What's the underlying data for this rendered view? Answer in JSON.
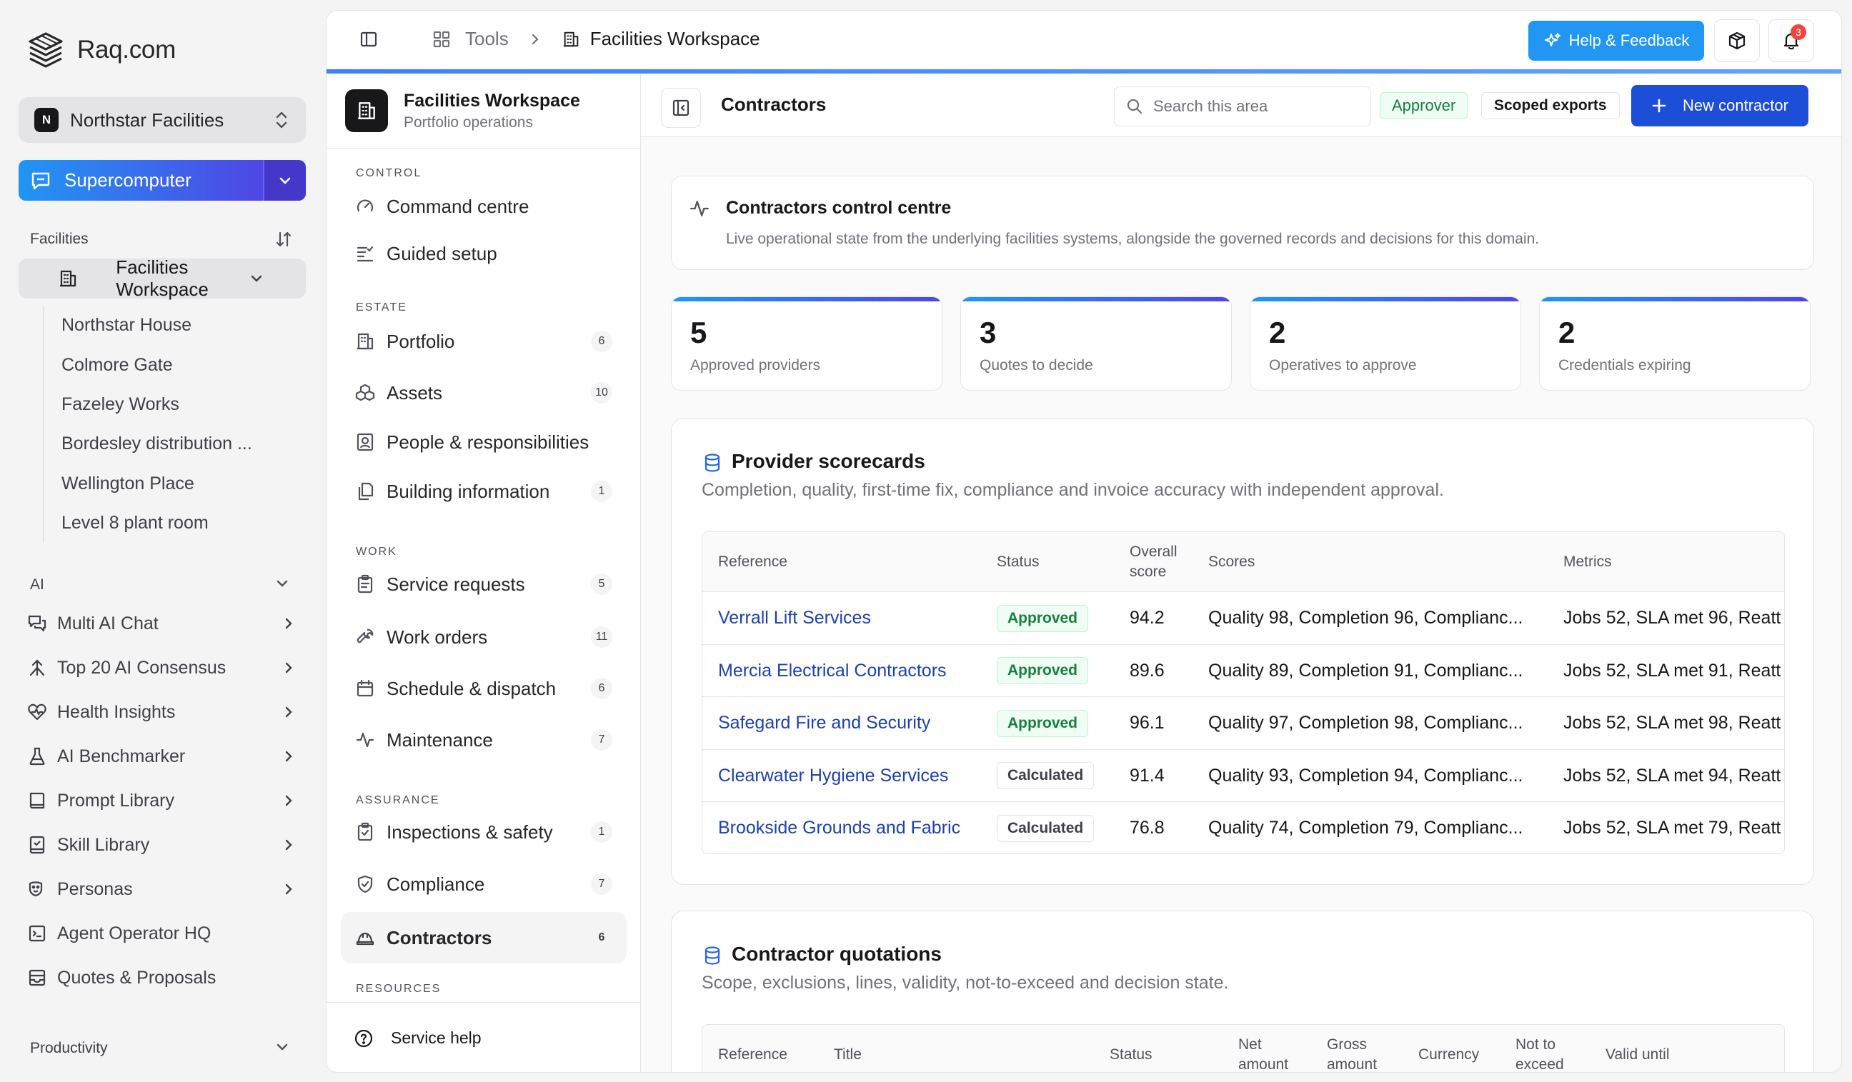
{
  "app": {
    "brand": "Raq.com"
  },
  "org": {
    "badge": "N",
    "name": "Northstar Facilities"
  },
  "supercomputer": {
    "label": "Supercomputer"
  },
  "facilities": {
    "heading": "Facilities",
    "workspace": "Facilities Workspace",
    "sites": [
      "Northstar House",
      "Colmore Gate",
      "Fazeley Works",
      "Bordesley distribution ...",
      "Wellington Place",
      "Level 8 plant room"
    ]
  },
  "ai": {
    "heading": "AI",
    "items": [
      {
        "label": "Multi AI Chat",
        "icon": "chat-icon",
        "chevron": true
      },
      {
        "label": "Top 20 AI Consensus",
        "icon": "consensus-icon",
        "chevron": true
      },
      {
        "label": "Health Insights",
        "icon": "heart-pulse-icon",
        "chevron": true
      },
      {
        "label": "AI Benchmarker",
        "icon": "flask-icon",
        "chevron": true
      },
      {
        "label": "Prompt Library",
        "icon": "book-icon",
        "chevron": true
      },
      {
        "label": "Skill Library",
        "icon": "skill-book-icon",
        "chevron": true
      },
      {
        "label": "Personas",
        "icon": "persona-icon",
        "chevron": true
      },
      {
        "label": "Agent Operator HQ",
        "icon": "terminal-icon",
        "chevron": false
      },
      {
        "label": "Quotes & Proposals",
        "icon": "inbox-icon",
        "chevron": false
      }
    ]
  },
  "productivity": {
    "heading": "Productivity"
  },
  "topbar": {
    "crumb_tools": "Tools",
    "crumb_current": "Facilities Workspace",
    "help_label": "Help & Feedback",
    "notif_count": "3"
  },
  "workspace": {
    "title": "Facilities Workspace",
    "subtitle": "Portfolio operations",
    "groups": {
      "control": "CONTROL",
      "estate": "ESTATE",
      "work": "WORK",
      "assurance": "ASSURANCE",
      "resources": "RESOURCES"
    },
    "items": {
      "command": {
        "label": "Command centre"
      },
      "guided": {
        "label": "Guided setup"
      },
      "portfolio": {
        "label": "Portfolio",
        "count": "6"
      },
      "assets": {
        "label": "Assets",
        "count": "10"
      },
      "people": {
        "label": "People & responsibilities"
      },
      "building": {
        "label": "Building information",
        "count": "1"
      },
      "service": {
        "label": "Service requests",
        "count": "5"
      },
      "workorders": {
        "label": "Work orders",
        "count": "11"
      },
      "schedule": {
        "label": "Schedule & dispatch",
        "count": "6"
      },
      "maintenance": {
        "label": "Maintenance",
        "count": "7"
      },
      "inspections": {
        "label": "Inspections & safety",
        "count": "1"
      },
      "compliance": {
        "label": "Compliance",
        "count": "7"
      },
      "contractors": {
        "label": "Contractors",
        "count": "6"
      }
    },
    "footer": "Service help"
  },
  "content": {
    "title": "Contractors",
    "search_placeholder": "Search this area",
    "role_chip": "Approver",
    "exports_chip": "Scoped exports",
    "new_button": "New contractor",
    "control": {
      "title": "Contractors control centre",
      "desc": "Live operational state from the underlying facilities systems, alongside the governed records and decisions for this domain."
    },
    "stats": [
      {
        "value": "5",
        "label": "Approved providers"
      },
      {
        "value": "3",
        "label": "Quotes to decide"
      },
      {
        "value": "2",
        "label": "Operatives to approve"
      },
      {
        "value": "2",
        "label": "Credentials expiring"
      }
    ],
    "scorecards": {
      "title": "Provider scorecards",
      "desc": "Completion, quality, first-time fix, compliance and invoice accuracy with independent approval.",
      "columns": {
        "reference": "Reference",
        "status": "Status",
        "overall": "Overall score",
        "scores": "Scores",
        "metrics": "Metrics"
      },
      "rows": [
        {
          "reference": "Verrall Lift Services",
          "status": "Approved",
          "overall": "94.2",
          "scores": "Quality 98, Completion 96, Complianc...",
          "metrics": "Jobs 52, SLA met 96, Reatt"
        },
        {
          "reference": "Mercia Electrical Contractors",
          "status": "Approved",
          "overall": "89.6",
          "scores": "Quality 89, Completion 91, Complianc...",
          "metrics": "Jobs 52, SLA met 91, Reatt"
        },
        {
          "reference": "Safegard Fire and Security",
          "status": "Approved",
          "overall": "96.1",
          "scores": "Quality 97, Completion 98, Complianc...",
          "metrics": "Jobs 52, SLA met 98, Reatt"
        },
        {
          "reference": "Clearwater Hygiene Services",
          "status": "Calculated",
          "overall": "91.4",
          "scores": "Quality 93, Completion 94, Complianc...",
          "metrics": "Jobs 52, SLA met 94, Reatt"
        },
        {
          "reference": "Brookside Grounds and Fabric",
          "status": "Calculated",
          "overall": "76.8",
          "scores": "Quality 74, Completion 79, Complianc...",
          "metrics": "Jobs 52, SLA met 79, Reatt"
        }
      ]
    },
    "quotations": {
      "title": "Contractor quotations",
      "desc": "Scope, exclusions, lines, validity, not-to-exceed and decision state.",
      "columns": {
        "reference": "Reference",
        "title": "Title",
        "status": "Status",
        "net": "Net amount",
        "gross": "Gross amount",
        "currency": "Currency",
        "nte": "Not to exceed",
        "valid": "Valid until"
      }
    }
  }
}
